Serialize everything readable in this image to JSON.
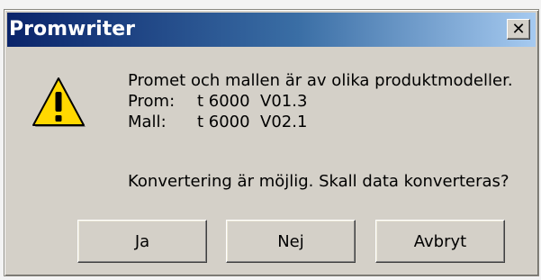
{
  "window": {
    "title": "Promwriter",
    "close_glyph": "✕"
  },
  "icon": {
    "name": "warning-icon",
    "color": "#ffd800"
  },
  "message": {
    "line1": "Promet och mallen är av olika produktmodeller.",
    "prom_label": "Prom:",
    "prom_value": "t 6000  V01.3",
    "mall_label": "Mall:",
    "mall_value": "t 6000  V02.1",
    "question": "Konvertering är möjlig. Skall data konverteras?"
  },
  "buttons": {
    "yes": "Ja",
    "no": "Nej",
    "cancel": "Avbryt"
  }
}
